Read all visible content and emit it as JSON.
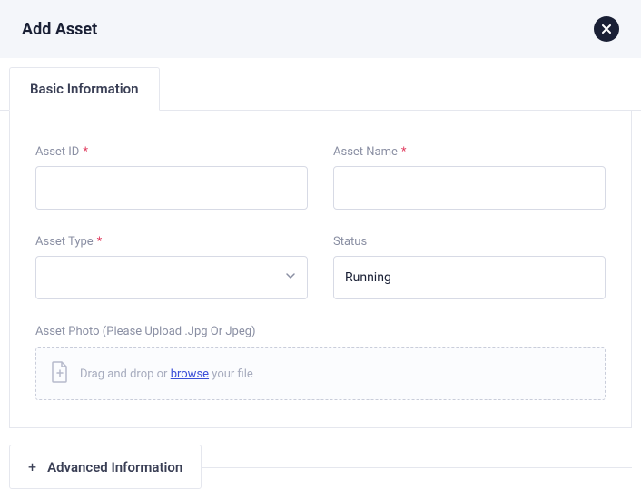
{
  "header": {
    "title": "Add Asset"
  },
  "tabs": {
    "basic": "Basic Information"
  },
  "fields": {
    "asset_id": {
      "label": "Asset ID",
      "value": ""
    },
    "asset_name": {
      "label": "Asset Name",
      "value": ""
    },
    "asset_type": {
      "label": "Asset Type",
      "value": ""
    },
    "status": {
      "label": "Status",
      "value": "Running"
    }
  },
  "upload": {
    "label": "Asset Photo (Please Upload .Jpg Or Jpeg)",
    "hint_prefix": "Drag and drop or ",
    "browse": "browse",
    "hint_suffix": " your file"
  },
  "accordion": {
    "advanced": "Advanced Information"
  }
}
